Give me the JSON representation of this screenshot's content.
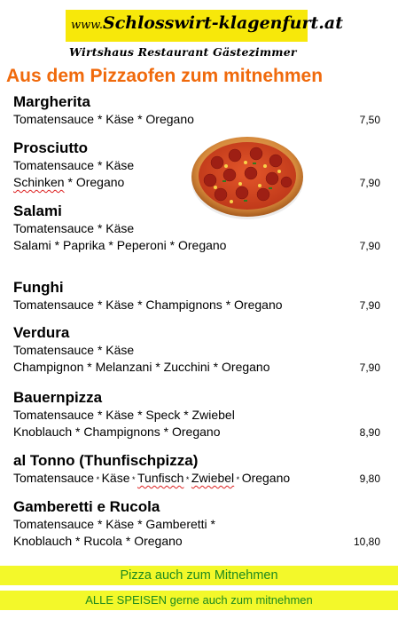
{
  "header": {
    "url_prefix": "www.",
    "url_main": "Schlosswirt-klagenfurt.at",
    "subtitle": "Wirtshaus Restaurant Gästezimmer"
  },
  "headline": "Aus dem Pizzaofen zum mitnehmen",
  "items": [
    {
      "name": "Margherita",
      "lines": [
        "Tomatensauce * Käse * Oregano"
      ],
      "price": "7,50"
    },
    {
      "name": "Prosciutto",
      "lines": [
        "Tomatensauce * Käse",
        "Schinken * Oregano"
      ],
      "price": "7,90"
    },
    {
      "name": "Salami",
      "lines": [
        "Tomatensauce * Käse",
        "Salami * Paprika * Peperoni * Oregano"
      ],
      "price": "7,90"
    },
    {
      "name": "Funghi",
      "lines": [
        "Tomatensauce * Käse * Champignons * Oregano"
      ],
      "price": "7,90"
    },
    {
      "name": "Verdura",
      "lines": [
        "Tomatensauce * Käse",
        "Champignon * Melanzani * Zucchini * Oregano"
      ],
      "price": "7,90"
    },
    {
      "name": "Bauernpizza",
      "lines": [
        "Tomatensauce * Käse * Speck * Zwiebel",
        "Knoblauch * Champignons * Oregano"
      ],
      "price": "8,90"
    },
    {
      "name": "al Tonno (Thunfischpizza)",
      "lines": [
        "Tomatensauce * Käse * Tunfisch * Zwiebel * Oregano"
      ],
      "price": "9,80"
    },
    {
      "name": "Gamberetti e Rucola",
      "lines": [
        "Tomatensauce * Käse * Gamberetti *",
        "Knoblauch * Rucola * Oregano"
      ],
      "price": "10,80"
    }
  ],
  "banners": {
    "pickup": "Pizza auch zum Mitnehmen",
    "all_dishes": "ALLE SPEISEN gerne auch zum mitnehmen"
  },
  "colors": {
    "headline": "#f06a0c",
    "banner_bg": "#f3f82a",
    "banner_text": "#1e8a1e",
    "logo_band": "#f7e80a"
  }
}
